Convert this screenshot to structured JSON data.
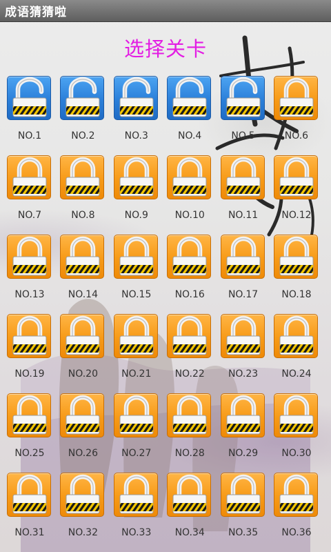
{
  "app": {
    "title": "成语猜猜啦"
  },
  "page": {
    "title": "选择关卡"
  },
  "colors": {
    "unlocked": "#2b7fd9",
    "locked": "#f79a17",
    "title": "#e31ce3"
  },
  "levels": [
    {
      "label": "NO.1",
      "state": "unlocked"
    },
    {
      "label": "NO.2",
      "state": "unlocked"
    },
    {
      "label": "NO.3",
      "state": "unlocked"
    },
    {
      "label": "NO.4",
      "state": "unlocked"
    },
    {
      "label": "NO.5",
      "state": "unlocked"
    },
    {
      "label": "NO.6",
      "state": "locked"
    },
    {
      "label": "NO.7",
      "state": "locked"
    },
    {
      "label": "NO.8",
      "state": "locked"
    },
    {
      "label": "NO.9",
      "state": "locked"
    },
    {
      "label": "NO.10",
      "state": "locked"
    },
    {
      "label": "NO.11",
      "state": "locked"
    },
    {
      "label": "NO.12",
      "state": "locked"
    },
    {
      "label": "NO.13",
      "state": "locked"
    },
    {
      "label": "NO.14",
      "state": "locked"
    },
    {
      "label": "NO.15",
      "state": "locked"
    },
    {
      "label": "NO.16",
      "state": "locked"
    },
    {
      "label": "NO.17",
      "state": "locked"
    },
    {
      "label": "NO.18",
      "state": "locked"
    },
    {
      "label": "NO.19",
      "state": "locked"
    },
    {
      "label": "NO.20",
      "state": "locked"
    },
    {
      "label": "NO.21",
      "state": "locked"
    },
    {
      "label": "NO.22",
      "state": "locked"
    },
    {
      "label": "NO.23",
      "state": "locked"
    },
    {
      "label": "NO.24",
      "state": "locked"
    },
    {
      "label": "NO.25",
      "state": "locked"
    },
    {
      "label": "NO.26",
      "state": "locked"
    },
    {
      "label": "NO.27",
      "state": "locked"
    },
    {
      "label": "NO.28",
      "state": "locked"
    },
    {
      "label": "NO.29",
      "state": "locked"
    },
    {
      "label": "NO.30",
      "state": "locked"
    },
    {
      "label": "NO.31",
      "state": "locked"
    },
    {
      "label": "NO.32",
      "state": "locked"
    },
    {
      "label": "NO.33",
      "state": "locked"
    },
    {
      "label": "NO.34",
      "state": "locked"
    },
    {
      "label": "NO.35",
      "state": "locked"
    },
    {
      "label": "NO.36",
      "state": "locked"
    }
  ]
}
